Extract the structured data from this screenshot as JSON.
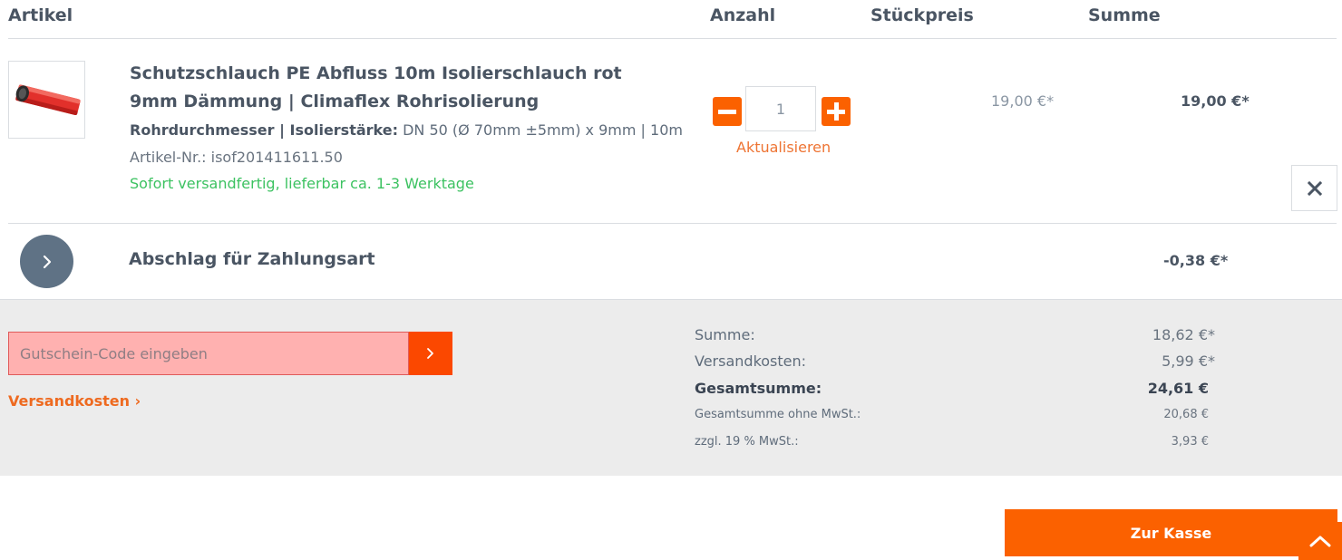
{
  "header": {
    "col_article": "Artikel",
    "col_quantity": "Anzahl",
    "col_unit_price": "Stückpreis",
    "col_sum": "Summe"
  },
  "product": {
    "name": "Schutzschlauch PE Abfluss 10m Isolierschlauch rot 9mm Dämmung | Climaflex Rohrisolierung",
    "property_label": "Rohrdurchmesser | Isolierstärke:",
    "property_value": "DN 50 (Ø 70mm ±5mm) x 9mm | 10m",
    "article_no": "Artikel-Nr.: isof201411611.50",
    "delivery": "Sofort versandfertig, lieferbar ca. 1-3 Werktage",
    "quantity": "1",
    "update_label": "Aktualisieren",
    "unit_price": "19,00 €*",
    "sum": "19,00 €*",
    "remove_icon": "close-icon"
  },
  "discount": {
    "name": "Abschlag für Zahlungsart",
    "value": "-0,38 €*"
  },
  "voucher": {
    "placeholder": "Gutschein-Code eingeben"
  },
  "shipping_link": "Versandkosten ›",
  "totals": {
    "sum_label": "Summe:",
    "sum_value": "18,62 €*",
    "shipping_label": "Versandkosten:",
    "shipping_value": "5,99 €*",
    "grand_label": "Gesamtsumme:",
    "grand_value": "24,61 €",
    "net_label": "Gesamtsumme ohne MwSt.:",
    "net_value": "20,68 €",
    "vat_label": "zzgl. 19 % MwSt.:",
    "vat_value": "3,93 €"
  },
  "checkout_label": "Zur Kasse",
  "colors": {
    "accent": "#fb6100",
    "delivery_green": "#3cc261",
    "voucher_error_bg": "#ffb1b0",
    "grey_panel": "#ececec"
  }
}
